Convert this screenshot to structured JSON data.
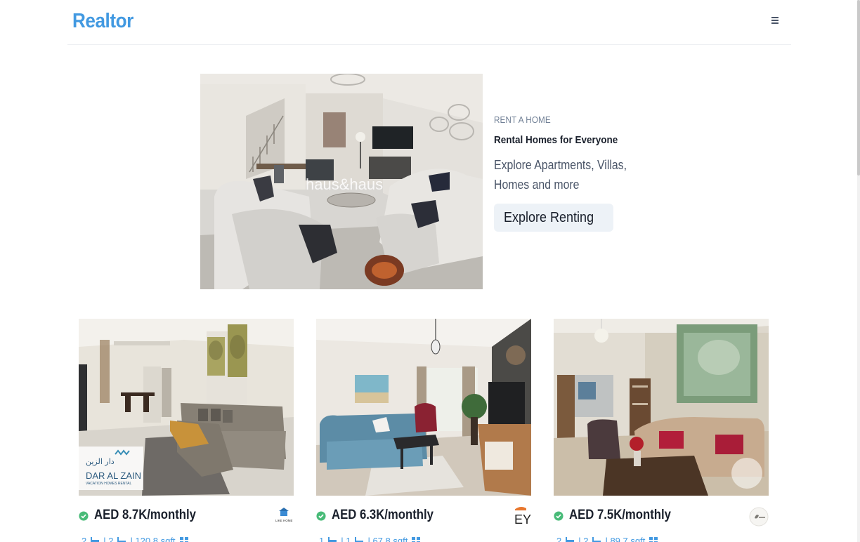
{
  "app": {
    "logo": "Realtor"
  },
  "navbar": {
    "menu_icon": "hamburger-menu-icon"
  },
  "banner": {
    "purpose": "RENT A HOME",
    "title": "Rental Homes for Everyone",
    "desc": "Explore Apartments, Villas, Homes and more",
    "button": "Explore Renting",
    "image_watermark": "haus&haus"
  },
  "cards": [
    {
      "price": "AED 8.7K/monthly",
      "rooms": "2",
      "baths": "| 2",
      "area": "| 120.8 sqft",
      "verified_icon": "check-badge-icon",
      "agency": "LIKE HOME",
      "image_logo": [
        "دار الزين",
        "DAR AL ZAIN",
        "VACATION HOMES RENTAL"
      ]
    },
    {
      "price": "AED 6.3K/monthly",
      "rooms": "1",
      "baths": "| 1",
      "area": "| 67.8 sqft",
      "verified_icon": "check-badge-icon",
      "agency": "EY"
    },
    {
      "price": "AED 7.5K/monthly",
      "rooms": "2",
      "baths": "| 2",
      "area": "| 89.7 sqft",
      "verified_icon": "check-badge-icon",
      "agency": ""
    }
  ],
  "colors": {
    "brand": "#4299e1",
    "verified": "#48bb78",
    "button_bg": "#edf2f7"
  }
}
